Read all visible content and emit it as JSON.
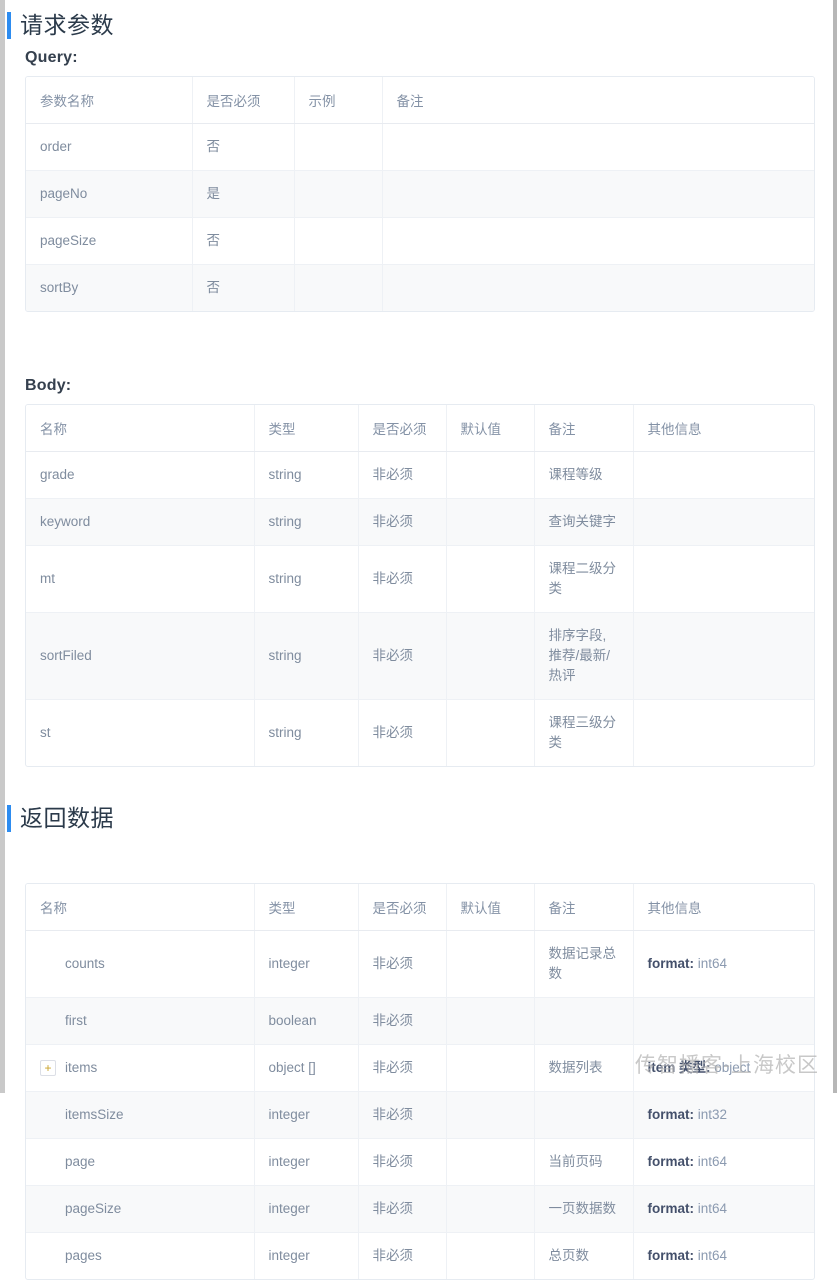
{
  "sections": {
    "request": {
      "title": "请求参数",
      "query_label": "Query:",
      "body_label": "Body:"
    },
    "response": {
      "title": "返回数据"
    }
  },
  "query_table": {
    "headers": [
      "参数名称",
      "是否必须",
      "示例",
      "备注"
    ],
    "rows": [
      {
        "name": "order",
        "required": "否",
        "example": "",
        "remark": ""
      },
      {
        "name": "pageNo",
        "required": "是",
        "example": "",
        "remark": ""
      },
      {
        "name": "pageSize",
        "required": "否",
        "example": "",
        "remark": ""
      },
      {
        "name": "sortBy",
        "required": "否",
        "example": "",
        "remark": ""
      }
    ]
  },
  "body_table": {
    "headers": [
      "名称",
      "类型",
      "是否必须",
      "默认值",
      "备注",
      "其他信息"
    ],
    "rows": [
      {
        "name": "grade",
        "type": "string",
        "required": "非必须",
        "default": "",
        "remark": "课程等级",
        "other_label": "",
        "other_value": ""
      },
      {
        "name": "keyword",
        "type": "string",
        "required": "非必须",
        "default": "",
        "remark": "查询关键字",
        "other_label": "",
        "other_value": ""
      },
      {
        "name": "mt",
        "type": "string",
        "required": "非必须",
        "default": "",
        "remark": "课程二级分类",
        "other_label": "",
        "other_value": ""
      },
      {
        "name": "sortFiled",
        "type": "string",
        "required": "非必须",
        "default": "",
        "remark": "排序字段, 推荐/最新/热评",
        "other_label": "",
        "other_value": ""
      },
      {
        "name": "st",
        "type": "string",
        "required": "非必须",
        "default": "",
        "remark": "课程三级分类",
        "other_label": "",
        "other_value": ""
      }
    ]
  },
  "response_table": {
    "headers": [
      "名称",
      "类型",
      "是否必须",
      "默认值",
      "备注",
      "其他信息"
    ],
    "rows": [
      {
        "name": "counts",
        "expandable": false,
        "type": "integer",
        "required": "非必须",
        "default": "",
        "remark": "数据记录总数",
        "other_label": "format:",
        "other_value": "int64"
      },
      {
        "name": "first",
        "expandable": false,
        "type": "boolean",
        "required": "非必须",
        "default": "",
        "remark": "",
        "other_label": "",
        "other_value": ""
      },
      {
        "name": "items",
        "expandable": true,
        "type": "object []",
        "required": "非必须",
        "default": "",
        "remark": "数据列表",
        "other_label": "item 类型:",
        "other_value": "object"
      },
      {
        "name": "itemsSize",
        "expandable": false,
        "type": "integer",
        "required": "非必须",
        "default": "",
        "remark": "",
        "other_label": "format:",
        "other_value": "int32"
      },
      {
        "name": "page",
        "expandable": false,
        "type": "integer",
        "required": "非必须",
        "default": "",
        "remark": "当前页码",
        "other_label": "format:",
        "other_value": "int64"
      },
      {
        "name": "pageSize",
        "expandable": false,
        "type": "integer",
        "required": "非必须",
        "default": "",
        "remark": "一页数据数",
        "other_label": "format:",
        "other_value": "int64"
      },
      {
        "name": "pages",
        "expandable": false,
        "type": "integer",
        "required": "非必须",
        "default": "",
        "remark": "总页数",
        "other_label": "format:",
        "other_value": "int64"
      }
    ],
    "expander_symbol": "+"
  },
  "watermark": {
    "text": "传智播客-上海校区"
  },
  "colors": {
    "accent": "#2d8cf0",
    "heading_text": "#2b3a4a",
    "table_text": "#7f8c9e",
    "stripe": "#f8f9fa",
    "border": "#e6ebf1"
  }
}
